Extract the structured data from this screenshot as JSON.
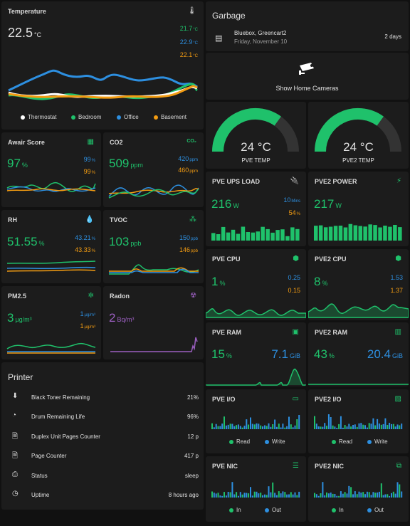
{
  "temperature": {
    "title": "Temperature",
    "value": "22.5",
    "unit": "°C",
    "readings": [
      {
        "value": "21.7",
        "unit": "°C",
        "color": "#1fc16b"
      },
      {
        "value": "22.9",
        "unit": "°C",
        "color": "#2d8fe0"
      },
      {
        "value": "22.1",
        "unit": "°C",
        "color": "#f39c12"
      }
    ],
    "legend": [
      "Thermostat",
      "Bedroom",
      "Office",
      "Basement"
    ],
    "icon": "thermometer-icon"
  },
  "garbage": {
    "title": "Garbage",
    "event_title": "Bluebox, Greencart2",
    "event_date": "Friday, November 10",
    "event_in": "2 days",
    "icon": "calendar-icon"
  },
  "cameras": {
    "label": "Show Home Cameras",
    "icon": "cctv-icon"
  },
  "gauges": [
    {
      "value": "24 °C",
      "label": "PVE TEMP",
      "fraction": 0.7
    },
    {
      "value": "24 °C",
      "label": "PVE2 TEMP",
      "fraction": 0.7
    }
  ],
  "sensors": {
    "awair": {
      "title": "Awair Score",
      "value": "97",
      "unit": "%",
      "a": "99",
      "a_unit": "%",
      "b": "99",
      "b_unit": "%",
      "icon": "grid-icon"
    },
    "co2": {
      "title": "CO2",
      "value": "509",
      "unit": "ppm",
      "a": "420",
      "a_unit": "ppm",
      "b": "460",
      "b_unit": "ppm",
      "icon": "co2-icon"
    },
    "rh": {
      "title": "RH",
      "value": "51.55",
      "unit": "%",
      "a": "43.21",
      "a_unit": "%",
      "b": "43.33",
      "b_unit": "%",
      "icon": "water-drop-icon"
    },
    "tvoc": {
      "title": "TVOC",
      "value": "103",
      "unit": "ppb",
      "a": "150",
      "a_unit": "ppb",
      "b": "146",
      "b_unit": "ppb",
      "icon": "molecule-icon"
    },
    "pm25": {
      "title": "PM2.5",
      "value": "3",
      "unit": "µg/m³",
      "a": "1",
      "a_unit": "µg/m³",
      "b": "1",
      "b_unit": "µg/m³",
      "icon": "virus-icon"
    },
    "radon": {
      "title": "Radon",
      "value": "2",
      "unit": "Bq/m³",
      "icon": "radioactive-icon"
    }
  },
  "printer": {
    "title": "Printer",
    "rows": [
      {
        "label": "Black Toner Remaining",
        "value": "21%",
        "icon": "toner-icon"
      },
      {
        "label": "Drum Remaining Life",
        "value": "96%",
        "icon": "donut-icon"
      },
      {
        "label": "Duplex Unit Pages Counter",
        "value": "12 p",
        "icon": "file-icon"
      },
      {
        "label": "Page Counter",
        "value": "417 p",
        "icon": "file-icon"
      },
      {
        "label": "Status",
        "value": "sleep",
        "icon": "printer-icon"
      },
      {
        "label": "Uptime",
        "value": "8 hours ago",
        "icon": "clock-icon"
      }
    ]
  },
  "server": {
    "ups": {
      "title": "PVE UPS LOAD",
      "value": "216",
      "unit": "W",
      "a": "10",
      "a_unit": "Mins",
      "b": "54",
      "b_unit": "%",
      "icon": "plug-icon"
    },
    "pve2_power": {
      "title": "PVE2 POWER",
      "value": "217",
      "unit": "W",
      "icon": "lightning-icon"
    },
    "cpu": {
      "title": "PVE CPU",
      "value": "1",
      "unit": "%",
      "a": "0.25",
      "b": "0.15",
      "icon": "cpu-icon"
    },
    "cpu2": {
      "title": "PVE2 CPU",
      "value": "8",
      "unit": "%",
      "a": "1.53",
      "b": "1.37",
      "icon": "cpu-icon"
    },
    "ram": {
      "title": "PVE RAM",
      "value": "15",
      "unit": "%",
      "a": "7.1",
      "a_unit": "GiB",
      "icon": "chip-icon"
    },
    "ram2": {
      "title": "PVE2 RAM",
      "value": "43",
      "unit": "%",
      "a": "20.4",
      "a_unit": "GiB",
      "icon": "memory-icon"
    },
    "io": {
      "title": "PVE I/O",
      "legend": [
        "Read",
        "Write"
      ],
      "icon": "harddisk-icon"
    },
    "io2": {
      "title": "PVE2 I/O",
      "legend": [
        "Read",
        "Write"
      ],
      "icon": "sd-card-icon"
    },
    "nic": {
      "title": "PVE NIC",
      "legend": [
        "In",
        "Out"
      ],
      "icon": "server-icon"
    },
    "nic2": {
      "title": "PVE2 NIC",
      "legend": [
        "In",
        "Out"
      ],
      "icon": "lan-icon"
    }
  },
  "colors": {
    "green": "#1fc16b",
    "blue": "#2d8fe0",
    "orange": "#f39c12",
    "white": "#ffffff",
    "purple": "#9b5fc0",
    "card": "#1c1c1c"
  }
}
